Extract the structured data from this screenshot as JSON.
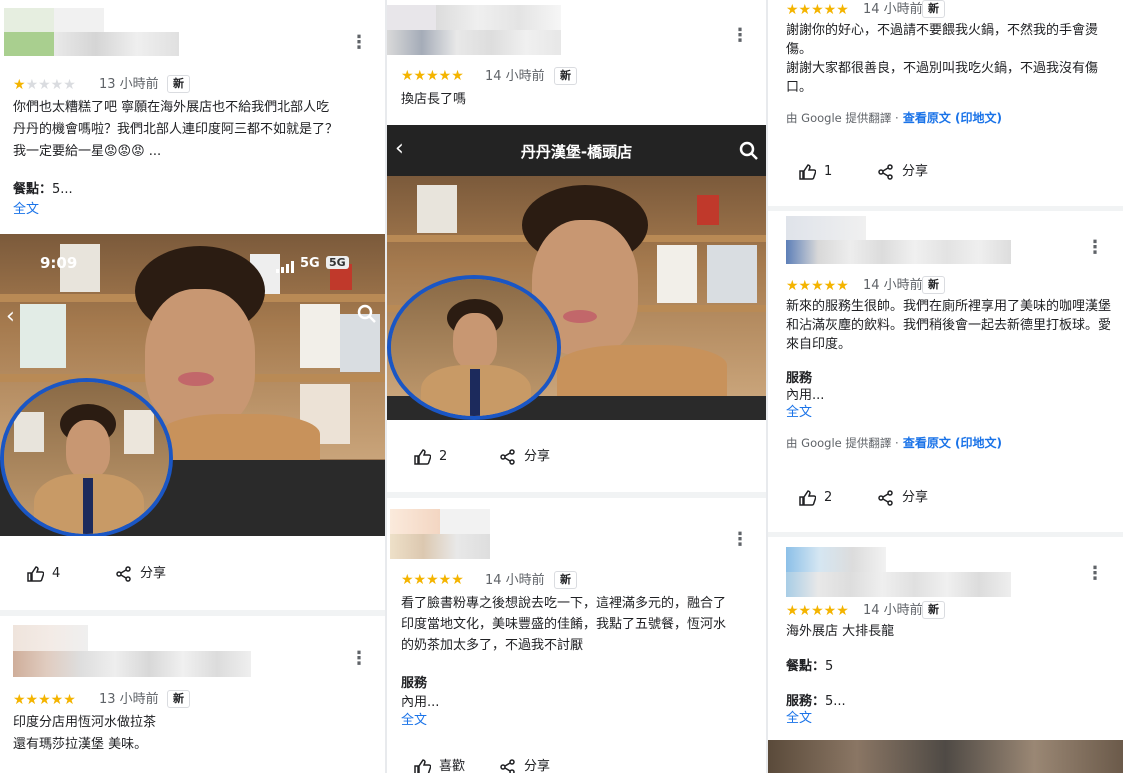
{
  "col1": {
    "review1": {
      "time": "13 小時前",
      "badge": "新",
      "text_line1": "你們也太糟糕了吧 寧願在海外展店也不給我們北部人吃",
      "text_line2": "丹丹的機會嗎啦？我們北部人連印度阿三都不如就是了？",
      "text_line3": "我一定要給一星😡😡😡 ...",
      "sub_label": "餐點：",
      "sub_value": "5...",
      "more": "全文",
      "likes": "4",
      "share": "分享"
    },
    "phone_status": {
      "time": "9:09",
      "network": "5G",
      "badge": "5G"
    },
    "review2": {
      "time": "13 小時前",
      "badge": "新",
      "text_line1": "印度分店用恆河水做拉茶",
      "text_line2": "還有瑪莎拉漢堡 美味。"
    }
  },
  "col2": {
    "review1": {
      "time": "14 小時前",
      "badge": "新",
      "text": "換店長了嗎",
      "header_title": "丹丹漢堡-橋頭店",
      "likes": "2",
      "share": "分享"
    },
    "review2": {
      "time": "14 小時前",
      "badge": "新",
      "text_line1": "看了臉書粉專之後想說去吃一下，這裡滿多元的，融合了",
      "text_line2": "印度當地文化，美味豐盛的佳餚，我點了五號餐，恆河水",
      "text_line3": "的奶茶加太多了，不過我不討厭",
      "sub_label": "服務",
      "sub_value": "內用...",
      "more": "全文",
      "like_label": "喜歡",
      "share": "分享"
    }
  },
  "col3": {
    "review1": {
      "time": "14 小時前",
      "badge": "新",
      "text_line1": "謝謝你的好心，不過請不要餵我火鍋，不然我的手會燙",
      "text_line2": "傷。",
      "text_line3": "謝謝大家都很善良，不過別叫我吃火鍋，不過我沒有傷",
      "text_line4": "口。",
      "translated_by": "由 Google 提供翻譯 ·",
      "view_original": "查看原文 (印地文)",
      "likes": "1",
      "share": "分享"
    },
    "review2": {
      "time": "14 小時前",
      "badge": "新",
      "text_line1": "新來的服務生很帥。我們在廁所裡享用了美味的咖哩漢堡",
      "text_line2": "和沾滿灰塵的飲料。我們稍後會一起去新德里打板球。愛",
      "text_line3": "來自印度。",
      "sub_label": "服務",
      "sub_value": "內用...",
      "more": "全文",
      "translated_by": "由 Google 提供翻譯 ·",
      "view_original": "查看原文 (印地文)",
      "likes": "2",
      "share": "分享"
    },
    "review3": {
      "time": "14 小時前",
      "badge": "新",
      "text": "海外展店 大排長龍",
      "sub1_label": "餐點：",
      "sub1_value": "5",
      "sub2_label": "服務：",
      "sub2_value": "5...",
      "more": "全文"
    }
  },
  "colors": {
    "star": "#f4b400",
    "link": "#1a73e8",
    "circle_border": "#1a56c4"
  }
}
